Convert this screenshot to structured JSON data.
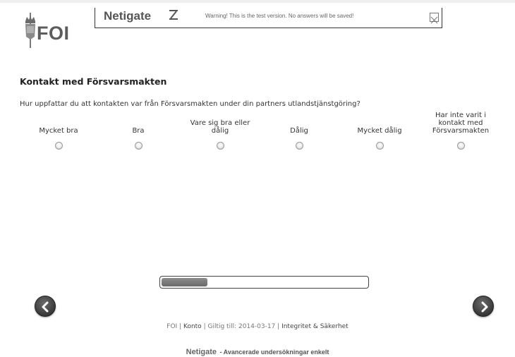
{
  "header": {
    "logo_text": "FOI",
    "brand": "Netigate",
    "warning": "Warning! This is the test version. No answers will be saved!",
    "close_icon": "close-icon"
  },
  "question": {
    "title": "Kontakt med Försvarsmakten",
    "text": "Hur uppfattar du att kontakten var från Försvarsmakten under din partners utlandstjänstgöring?",
    "options": [
      {
        "label": "Mycket bra"
      },
      {
        "label": "Bra"
      },
      {
        "label": "Vare sig bra eller dålig"
      },
      {
        "label": "Dålig"
      },
      {
        "label": "Mycket dålig"
      },
      {
        "label": "Har inte varit i kontakt med Försvarsmakten"
      }
    ]
  },
  "progress": {
    "value": 0.22
  },
  "nav": {
    "prev_icon": "chevron-left-icon",
    "next_icon": "chevron-right-icon"
  },
  "footer": {
    "org": "FOI",
    "account": "Konto",
    "valid_until": "Giltig till: 2014-03-17",
    "privacy": "Integritet & Säkerhet",
    "brand": "Netigate",
    "tagline": "- Avancerade undersökningar enkelt"
  }
}
